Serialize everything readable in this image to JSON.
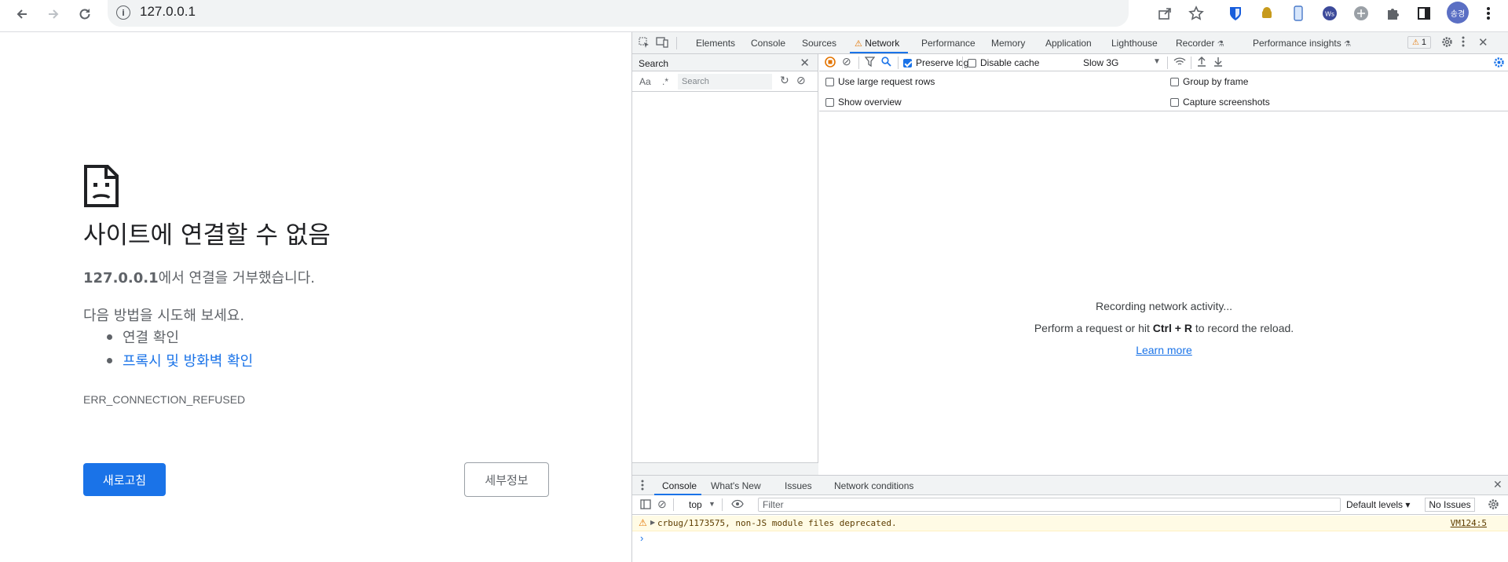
{
  "browser": {
    "url": "127.0.0.1",
    "profile_initials": "송경",
    "icons": [
      "back-icon",
      "forward-icon",
      "reload-icon",
      "info-icon",
      "share-icon",
      "star-icon",
      "bitwarden-icon",
      "android-icon",
      "device-icon",
      "ws-icon",
      "extension-icon",
      "puzzle-icon",
      "sidepanel-icon",
      "menu-icon"
    ]
  },
  "error_page": {
    "title": "사이트에 연결할 수 없음",
    "host": "127.0.0.1",
    "refused_text": "에서 연결을 거부했습니다.",
    "try_text": "다음 방법을 시도해 보세요.",
    "suggestions": [
      "연결 확인",
      "프록시 및 방화벽 확인"
    ],
    "error_code": "ERR_CONNECTION_REFUSED",
    "reload_button": "새로고침",
    "details_button": "세부정보"
  },
  "devtools": {
    "tabs": [
      "Elements",
      "Console",
      "Sources",
      "Network",
      "Performance",
      "Memory",
      "Application",
      "Lighthouse",
      "Recorder",
      "Performance insights"
    ],
    "active_tab": "Network",
    "warning_count": "1",
    "search": {
      "title": "Search",
      "aa": "Aa",
      "regex": ".*",
      "placeholder": "Search"
    },
    "network": {
      "preserve_log": "Preserve log",
      "disable_cache": "Disable cache",
      "throttling": "Slow 3G",
      "large_rows": "Use large request rows",
      "show_overview": "Show overview",
      "group_by_frame": "Group by frame",
      "capture_screenshots": "Capture screenshots",
      "recording": "Recording network activity...",
      "hint_prefix": "Perform a request or hit ",
      "hint_keys": "Ctrl + R",
      "hint_suffix": " to record the reload.",
      "learn_more": "Learn more"
    },
    "drawer": {
      "tabs": [
        "Console",
        "What's New",
        "Issues",
        "Network conditions"
      ],
      "context": "top",
      "filter_placeholder": "Filter",
      "levels": "Default levels ▾",
      "issues": "No Issues",
      "warning_message": "crbug/1173575, non-JS module files deprecated.",
      "warning_source": "VM124:5"
    }
  },
  "colors": {
    "accent": "#1a73e8",
    "toolbar_bg": "#f1f3f4",
    "warning_bg": "#fffbe5"
  }
}
